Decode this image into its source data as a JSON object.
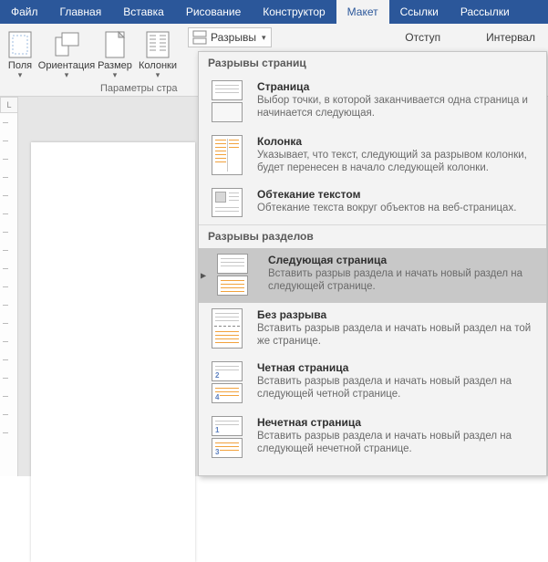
{
  "tabs": {
    "file": "Файл",
    "home": "Главная",
    "insert": "Вставка",
    "draw": "Рисование",
    "design": "Конструктор",
    "layout": "Макет",
    "references": "Ссылки",
    "mailings": "Рассылки"
  },
  "ribbon": {
    "margins": "Поля",
    "orientation": "Ориентация",
    "size": "Размер",
    "columns": "Колонки",
    "breaks": "Разрывы",
    "indent": "Отступ",
    "spacing": "Интервал",
    "group_caption": "Параметры стра"
  },
  "ruler_corner": "L",
  "dropdown": {
    "section_page_breaks": "Разрывы страниц",
    "section_section_breaks": "Разрывы разделов",
    "items": {
      "page": {
        "title": "Страница",
        "desc": "Выбор точки, в которой заканчивается одна страница и начинается следующая."
      },
      "column": {
        "title": "Колонка",
        "desc": "Указывает, что текст, следующий за разрывом колонки, будет перенесен в начало следующей колонки."
      },
      "textwrap": {
        "title": "Обтекание текстом",
        "desc": "Обтекание текста вокруг объектов на веб-страницах."
      },
      "nextpage": {
        "title": "Следующая страница",
        "desc": "Вставить разрыв раздела и начать новый раздел на следующей странице."
      },
      "continuous": {
        "title": "Без разрыва",
        "desc": "Вставить разрыв раздела и начать новый раздел на той же странице."
      },
      "evenpage": {
        "title": "Четная страница",
        "desc": "Вставить разрыв раздела и начать новый раздел на следующей четной странице."
      },
      "oddpage": {
        "title": "Нечетная страница",
        "desc": "Вставить разрыв раздела и начать новый раздел на следующей нечетной странице."
      }
    }
  }
}
